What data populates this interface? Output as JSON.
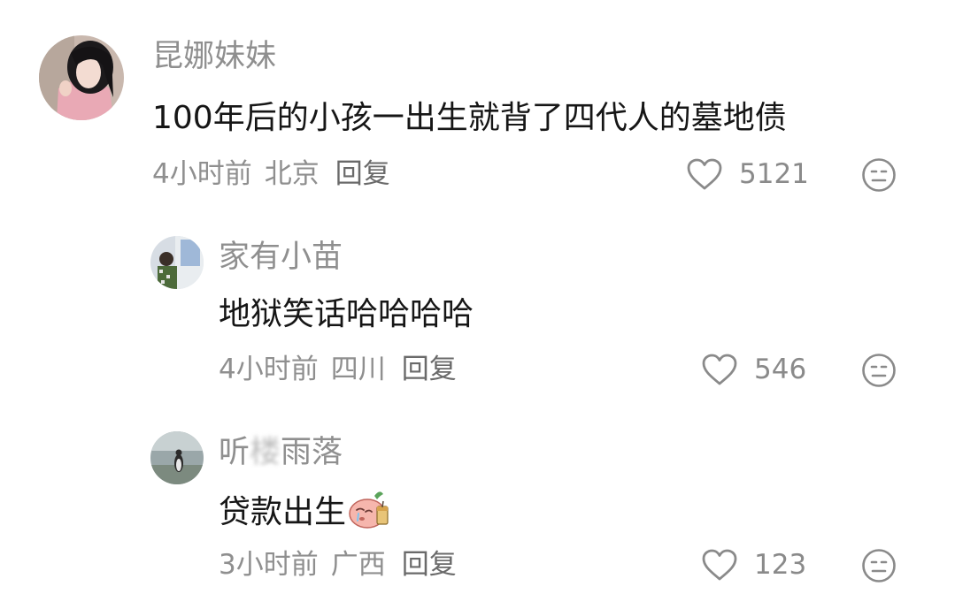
{
  "comments": [
    {
      "username": "昆娜妹妹",
      "text": "100年后的小孩一出生就背了四代人的墓地债",
      "time": "4小时前",
      "location": "北京",
      "reply_label": "回复",
      "likes": "5121",
      "like_icon": "heart-outline-icon",
      "dislike_icon": "neutral-face-icon"
    },
    {
      "username": "家有小苗",
      "text": "地狱笑话哈哈哈哈",
      "time": "4小时前",
      "location": "四川",
      "reply_label": "回复",
      "likes": "546",
      "like_icon": "heart-outline-icon",
      "dislike_icon": "neutral-face-icon"
    },
    {
      "username_prefix": "听",
      "username_obscured": "楼",
      "username_suffix": "雨落",
      "text": "贷款出生",
      "emoji": "crying-peach-sticker",
      "time": "3小时前",
      "location": "广西",
      "reply_label": "回复",
      "likes": "123",
      "like_icon": "heart-outline-icon",
      "dislike_icon": "neutral-face-icon"
    }
  ],
  "colors": {
    "secondary_text": "#8f8f8f",
    "primary_text": "#161616",
    "icon": "#8a8a8a"
  }
}
